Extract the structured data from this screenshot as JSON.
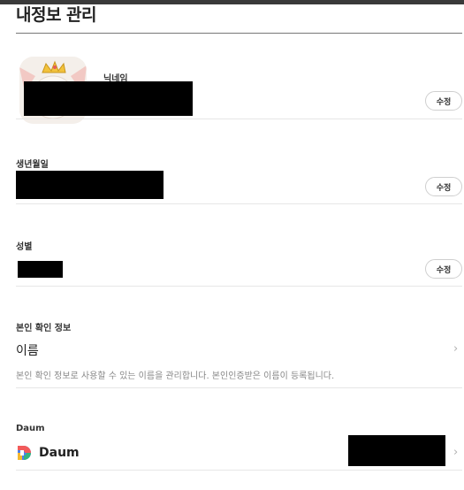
{
  "page": {
    "title": "내정보 관리"
  },
  "profile": {
    "nickname_label": "닉네임",
    "edit_label": "수정"
  },
  "birthday": {
    "label": "생년월일",
    "edit_label": "수정"
  },
  "gender": {
    "label": "성별",
    "edit_label": "수정"
  },
  "identity": {
    "section_label": "본인 확인 정보",
    "item_title": "이름",
    "description": "본인 확인 정보로 사용할 수 있는 이름을 관리합니다. 본인인증받은 이름이 등록됩니다.",
    "chevron_icon": "chevron-right-icon"
  },
  "daum": {
    "section_label": "Daum",
    "account_name": "Daum",
    "logo_icon": "daum-logo-icon",
    "chevron_icon": "chevron-right-icon"
  },
  "colors": {
    "redaction": "#000000",
    "divider": "#e6e6e6",
    "title_rule": "#777777"
  }
}
